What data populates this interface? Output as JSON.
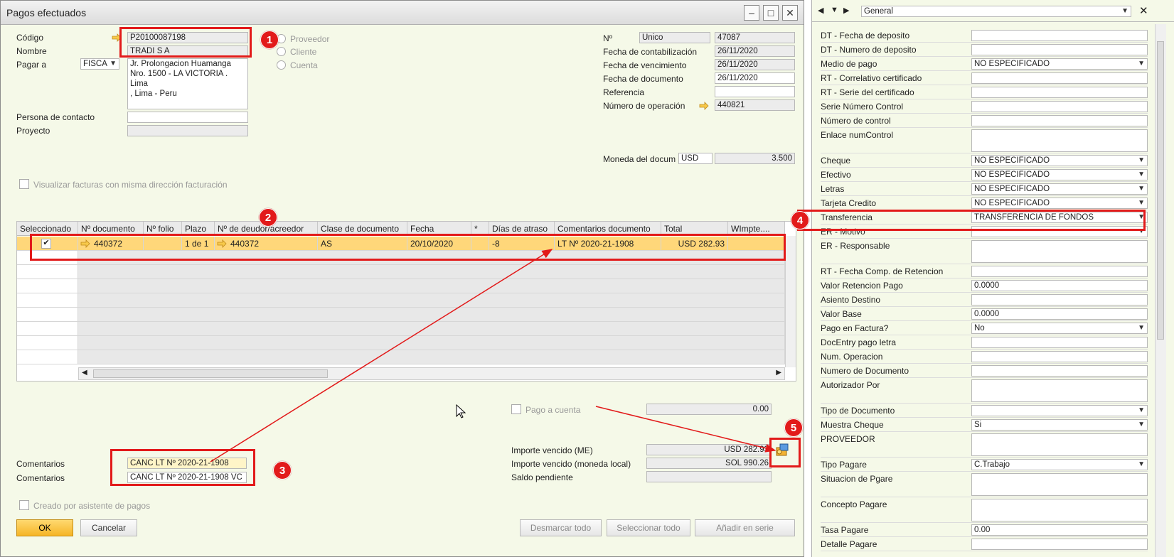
{
  "window": {
    "title": "Pagos efectuados"
  },
  "header": {
    "codigo_label": "Código",
    "codigo_value": "P20100087198",
    "nombre_label": "Nombre",
    "nombre_value": "TRADI S A",
    "pagar_a_label": "Pagar a",
    "pagar_a_value": "FISCA",
    "address_lines": [
      "Jr. Prolongacion Huamanga",
      "Nro. 1500 - LA VICTORIA .",
      "Lima",
      ", Lima - Peru"
    ],
    "contacto_label": "Persona de contacto",
    "proyecto_label": "Proyecto",
    "radio_proveedor": "Proveedor",
    "radio_cliente": "Cliente",
    "radio_cuenta": "Cuenta",
    "no_label": "Nº",
    "no_type": "Unico",
    "no_value": "47087",
    "fecha_cont_label": "Fecha de contabilización",
    "fecha_cont_value": "26/11/2020",
    "fecha_venc_label": "Fecha de vencimiento",
    "fecha_venc_value": "26/11/2020",
    "fecha_doc_label": "Fecha de documento",
    "fecha_doc_value": "26/11/2020",
    "referencia_label": "Referencia",
    "num_op_label": "Número de operación",
    "num_op_value": "440821",
    "moneda_label": "Moneda del docum",
    "moneda_code": "USD",
    "moneda_rate": "3.500",
    "visualizar_label": "Visualizar facturas con misma dirección facturación"
  },
  "grid": {
    "columns": [
      "Seleccionado",
      "Nº documento",
      "Nº folio",
      "Plazo",
      "Nº de deudor/acreedor",
      "Clase de documento",
      "Fecha",
      "*",
      "Días de atraso",
      "Comentarios documento",
      "Total",
      "WImpte...."
    ],
    "row": {
      "doc": "440372",
      "folio": "",
      "plazo": "1 de 1",
      "deudor": "440372",
      "clase": "AS",
      "fecha": "20/10/2020",
      "star": "",
      "dias": "-8",
      "comentarios": "LT Nº 2020-21-1908",
      "total": "USD 282.93",
      "wimpte": ""
    }
  },
  "footer": {
    "pago_cuenta_label": "Pago a cuenta",
    "pago_cuenta_value": "0.00",
    "comentarios_label": "Comentarios",
    "comentarios_value": "CANC LT Nº 2020-21-1908",
    "comentarios2_label": "Comentarios",
    "comentarios2_value": "CANC LT Nº 2020-21-1908 VC",
    "importe_me_label": "Importe vencido (ME)",
    "importe_me_value": "USD 282.93",
    "importe_ml_label": "Importe vencido (moneda local)",
    "importe_ml_value": "SOL 990.26",
    "saldo_label": "Saldo pendiente",
    "creado_label": "Creado por asistente de pagos",
    "ok": "OK",
    "cancelar": "Cancelar",
    "desmarcar": "Desmarcar todo",
    "seleccionar": "Seleccionar todo",
    "anadir": "Añadir en serie"
  },
  "annotations": [
    "1",
    "2",
    "3",
    "4",
    "5"
  ],
  "panel": {
    "dropdown": "General",
    "rows": [
      {
        "label": "DT - Fecha de deposito",
        "value": ""
      },
      {
        "label": "DT - Numero de deposito",
        "value": ""
      },
      {
        "label": "Medio de pago",
        "value": "NO ESPECIFICADO"
      },
      {
        "label": "RT - Correlativo certificado",
        "value": ""
      },
      {
        "label": "RT - Serie del certificado",
        "value": ""
      },
      {
        "label": "Serie Número Control",
        "value": ""
      },
      {
        "label": "Número de control",
        "value": ""
      },
      {
        "label": "Enlace numControl",
        "value": ""
      },
      {
        "label": "Cheque",
        "value": "NO ESPECIFICADO"
      },
      {
        "label": "Efectivo",
        "value": "NO ESPECIFICADO"
      },
      {
        "label": "Letras",
        "value": "NO ESPECIFICADO"
      },
      {
        "label": "Tarjeta Credito",
        "value": "NO ESPECIFICADO"
      },
      {
        "label": "Transferencia",
        "value": "TRANSFERENCIA DE FONDOS"
      },
      {
        "label": "ER - Motivo",
        "value": ""
      },
      {
        "label": "ER - Responsable",
        "value": ""
      },
      {
        "label": "RT - Fecha Comp. de Retencion",
        "value": ""
      },
      {
        "label": "Valor Retencion Pago",
        "value": "0.0000"
      },
      {
        "label": "Asiento Destino",
        "value": ""
      },
      {
        "label": "Valor Base",
        "value": "0.0000"
      },
      {
        "label": "Pago en Factura?",
        "value": "No"
      },
      {
        "label": "DocEntry pago letra",
        "value": ""
      },
      {
        "label": "Num. Operacion",
        "value": ""
      },
      {
        "label": "Numero de Documento",
        "value": ""
      },
      {
        "label": "Autorizador Por",
        "value": ""
      },
      {
        "label": "Tipo de Documento",
        "value": ""
      },
      {
        "label": "Muestra Cheque",
        "value": "Si"
      },
      {
        "label": "PROVEEDOR",
        "value": ""
      },
      {
        "label": "Tipo Pagare",
        "value": "C.Trabajo"
      },
      {
        "label": "Situacion de Pgare",
        "value": ""
      },
      {
        "label": "Concepto Pagare",
        "value": ""
      },
      {
        "label": "Tasa Pagare",
        "value": "0.00"
      },
      {
        "label": "Detalle Pagare",
        "value": ""
      }
    ]
  },
  "colors": {
    "accent_red": "#e21a1a",
    "selected_row": "#ffd77a",
    "background": "#f5f9e8"
  }
}
